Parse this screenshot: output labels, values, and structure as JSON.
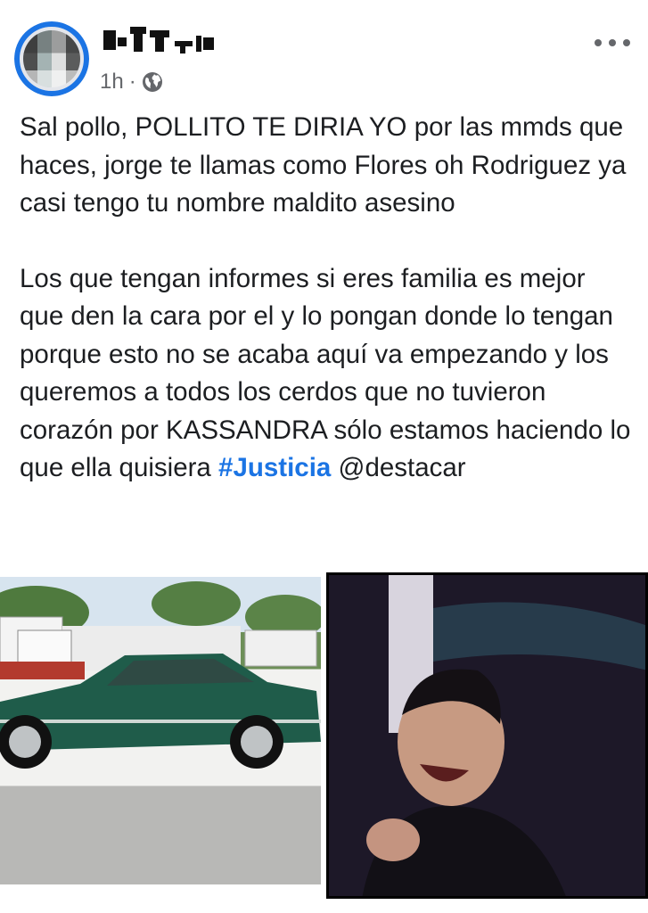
{
  "post": {
    "timestamp": "1h",
    "separator": "·",
    "privacy_icon": "globe-icon",
    "more_icon": "more-dots-icon",
    "paragraph1": "Sal pollo, POLLITO TE DIRIA YO por las mmds que haces, jorge te llamas como Flores oh Rodriguez ya casi tengo tu nombre maldito asesino",
    "paragraph2_text": "Los que tengan informes si eres familia es mejor que den la cara por el y lo pongan donde lo tengan porque esto no se acaba aquí va empezando y los queremos a todos los cerdos que no tuvieron corazón por KASSANDRA sólo estamos haciendo lo que ella quisiera",
    "hashtag": "#Justicia",
    "mention": "@destacar"
  },
  "colors": {
    "link_blue": "#1b74e4",
    "meta_gray": "#65676b",
    "car_green": "#1f5c4a"
  }
}
